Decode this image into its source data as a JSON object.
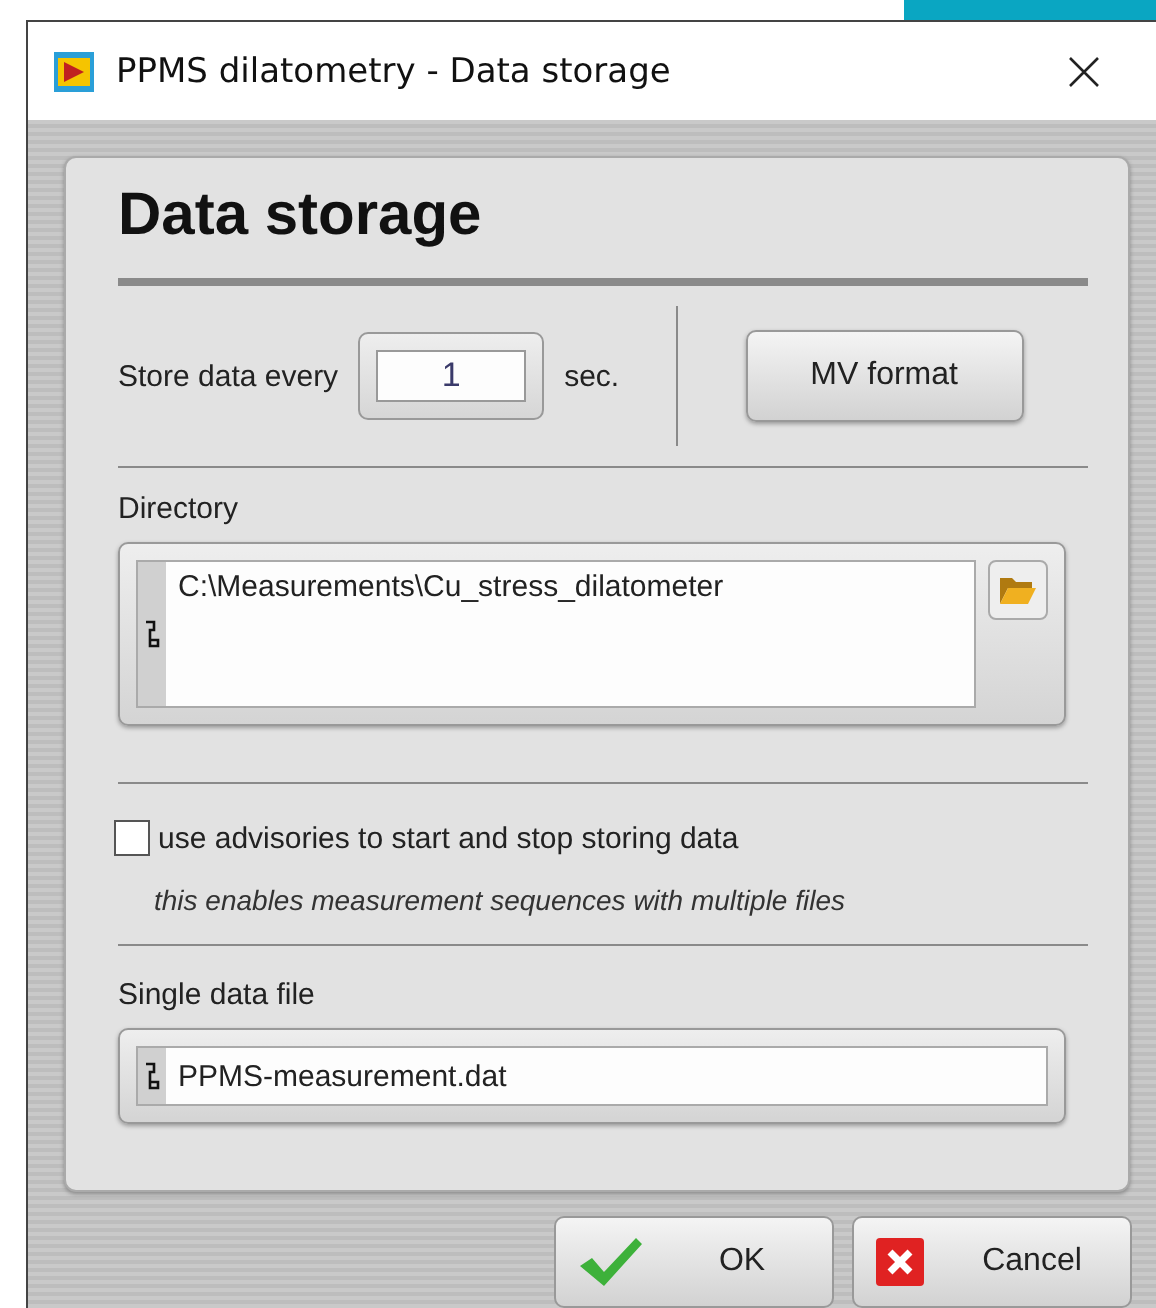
{
  "window": {
    "title": "PPMS dilatometry - Data storage"
  },
  "panel": {
    "heading": "Data storage"
  },
  "store_interval": {
    "label": "Store data every",
    "value": "1",
    "unit": "sec."
  },
  "format_button": {
    "label": "MV format"
  },
  "directory": {
    "label": "Directory",
    "value": "C:\\Measurements\\Cu_stress_dilatometer"
  },
  "advisories": {
    "label": "use advisories to start and stop storing data",
    "checked": false,
    "note": "this enables measurement sequences with multiple files"
  },
  "single_file": {
    "label": "Single data file",
    "value": "PPMS-measurement.dat"
  },
  "buttons": [
    {
      "label": "OK",
      "kind": "ok"
    },
    {
      "label": "Cancel",
      "kind": "cancel"
    }
  ]
}
